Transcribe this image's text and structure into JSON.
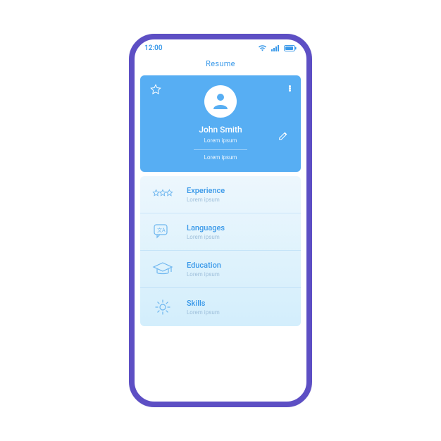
{
  "statusBar": {
    "time": "12:00"
  },
  "header": {
    "title": "Resume"
  },
  "profile": {
    "name": "John Smith",
    "subtitle": "Lorem ipsum",
    "description": "Lorem ipsum"
  },
  "sections": [
    {
      "id": "experience",
      "title": "Experience",
      "subtitle": "Lorem ipsum"
    },
    {
      "id": "languages",
      "title": "Languages",
      "subtitle": "Lorem ipsum"
    },
    {
      "id": "education",
      "title": "Education",
      "subtitle": "Lorem ipsum"
    },
    {
      "id": "skills",
      "title": "Skills",
      "subtitle": "Lorem ipsum"
    }
  ],
  "colors": {
    "frame": "#5d4fc4",
    "accent": "#57aef3",
    "text": "#3a99e9"
  }
}
